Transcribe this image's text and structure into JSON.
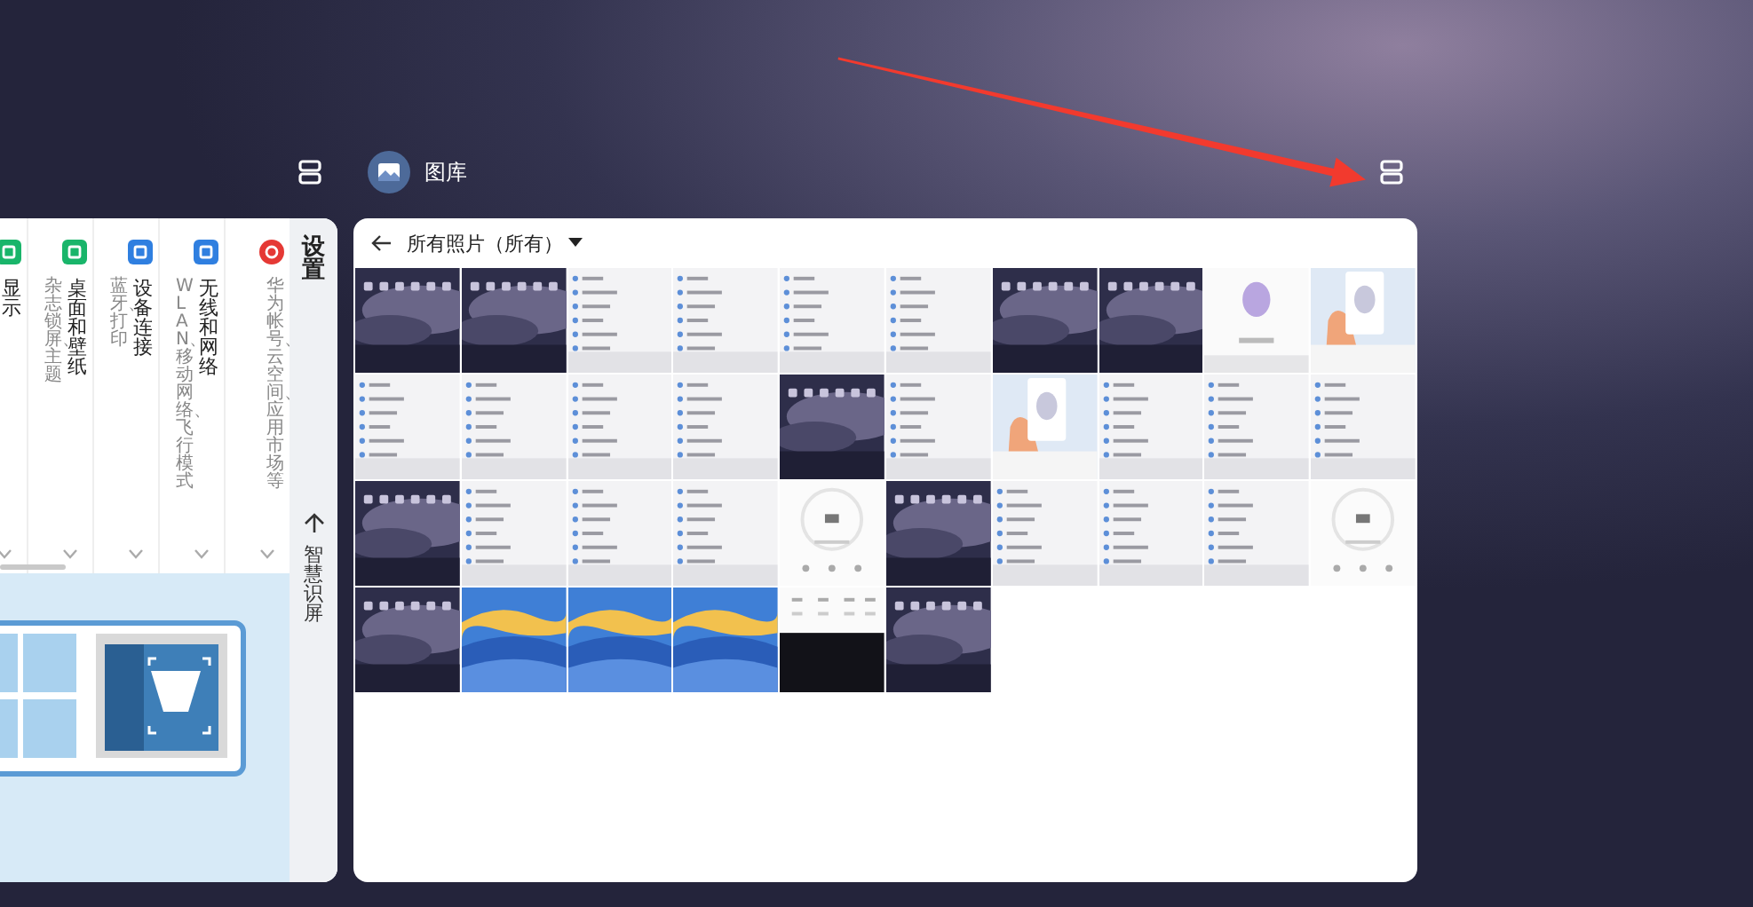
{
  "settings": {
    "title": "设置",
    "items": [
      {
        "kind": "setting",
        "title": "显示",
        "color": "#19b56a"
      },
      {
        "kind": "setting",
        "title": "桌面和壁纸",
        "subtitle": "杂志锁屏、主题",
        "color": "#19b56a"
      },
      {
        "kind": "setting",
        "title": "设备连接",
        "subtitle": "蓝牙、打印",
        "color": "#2f7fe0"
      },
      {
        "kind": "setting",
        "title": "无线和网络",
        "subtitle": "WLAN、移动网络、飞行模式",
        "color": "#2f7fe0"
      },
      {
        "kind": "account",
        "subtitle": "华为帐号、云空间、应用市场等",
        "color": "#e53935"
      }
    ],
    "smart_screen": {
      "label": "智慧识屏"
    }
  },
  "gallery": {
    "app_name": "图库",
    "album": "所有照片（所有）"
  },
  "annotation": {
    "kind": "arrow"
  }
}
